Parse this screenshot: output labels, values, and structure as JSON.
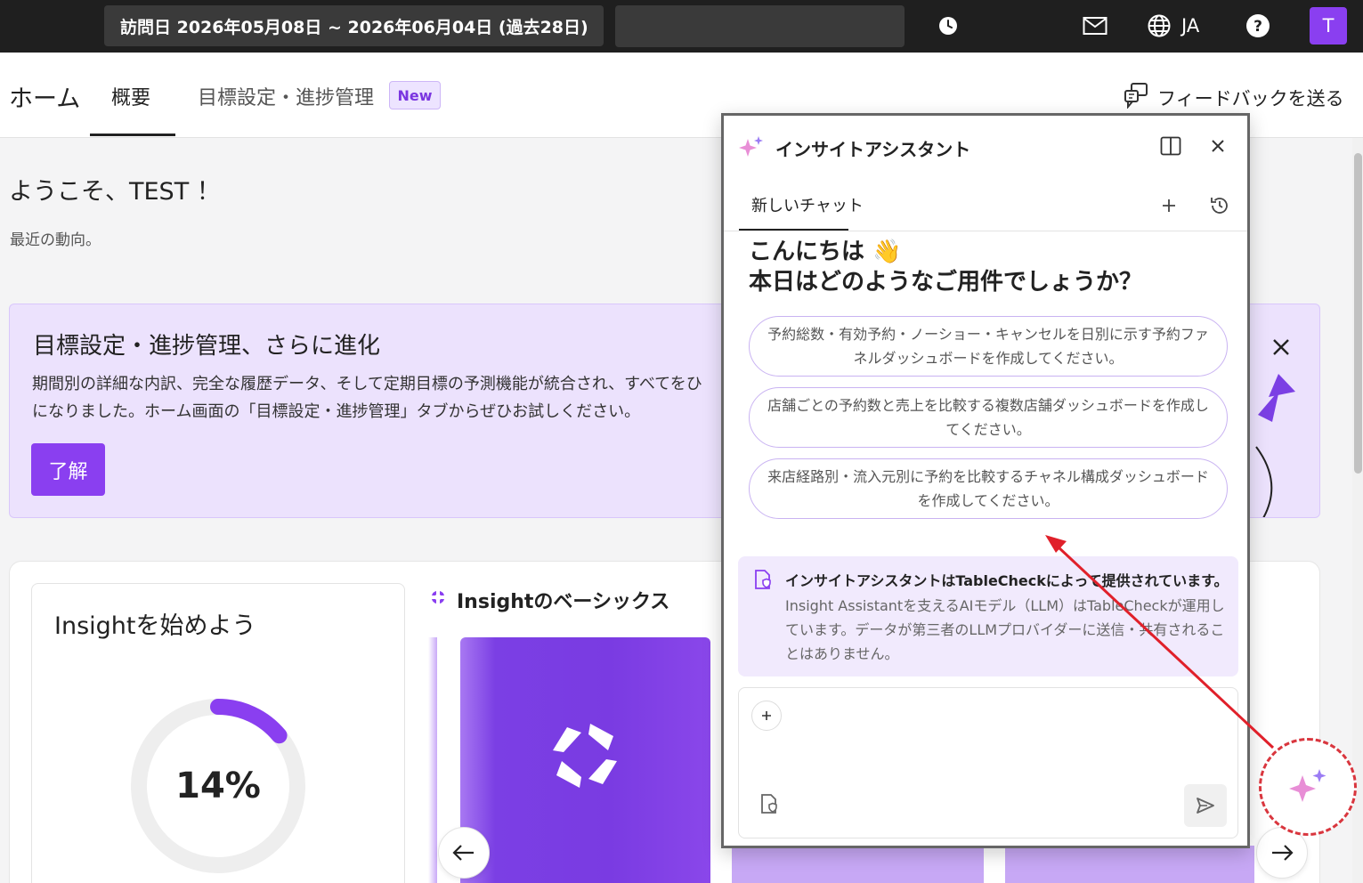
{
  "topbar": {
    "date_range": "訪問日 2026年05月08日 ~ 2026年06月04日 (過去28日)",
    "language": "JA",
    "avatar_initial": "T"
  },
  "tabs": {
    "home_title": "ホーム",
    "items": [
      {
        "label": "概要"
      },
      {
        "label": "目標設定・進捗管理"
      }
    ],
    "new_badge": "New",
    "feedback_label": "フィードバックを送る"
  },
  "main": {
    "welcome": "ようこそ、TEST ！",
    "subtitle": "最近の動向。"
  },
  "banner": {
    "title": "目標設定・進捗管理、さらに進化",
    "text_line1": "期間別の詳細な内訳、完全な履歴データ、そして定期目標の予測機能が統合され、すべてをひ",
    "text_line2": "になりました。ホーム画面の「目標設定・進捗管理」タブからぜひお試しください。",
    "ok_label": "了解"
  },
  "start_card": {
    "title": "Insightを始めよう",
    "progress_text": "14%",
    "progress_value": 0.14
  },
  "basics": {
    "title": "Insightのベーシックス"
  },
  "assistant": {
    "title": "インサイトアシスタント",
    "tab_label": "新しいチャット",
    "greeting_line1": "こんにちは 👋",
    "greeting_line2": "本日はどのようなご用件でしょうか？",
    "suggestions": [
      "予約総数・有効予約・ノーショー・キャンセルを日別に示す予約ファネルダッシュボードを作成してください。",
      "店舗ごとの予約数と売上を比較する複数店舗ダッシュボードを作成してください。",
      "来店経路別・流入元別に予約を比較するチャネル構成ダッシュボードを作成してください。"
    ],
    "notice_title": "インサイトアシスタントはTableCheckによって提供されています。",
    "notice_body": "Insight Assistantを支えるAIモデル（LLM）はTableCheckが運用しています。データが第三者のLLMプロバイダーに送信・共有されることはありません。"
  },
  "colors": {
    "accent": "#8a3ff0",
    "topbar": "#1f1f1f",
    "banner_bg": "#ece2fd",
    "annotation_red": "#e0202a"
  }
}
